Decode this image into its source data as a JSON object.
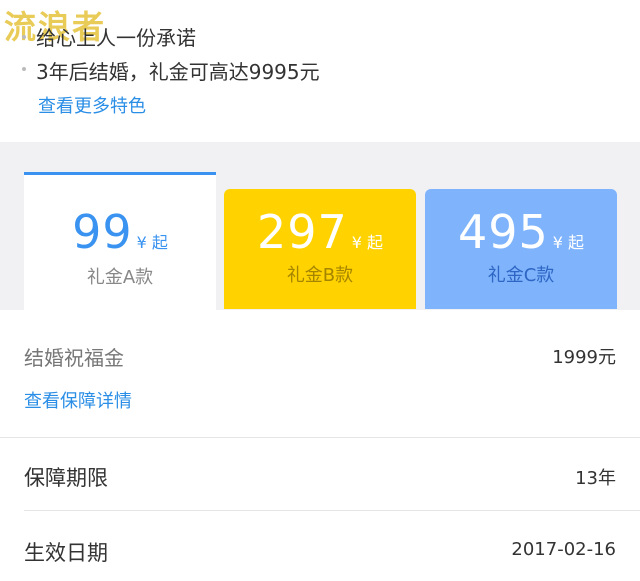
{
  "watermark": "流浪者",
  "features": {
    "items": [
      "给心上人一份承诺",
      "3年后结婚，礼金可高达9995元"
    ],
    "more_link": "查看更多特色"
  },
  "plans": [
    {
      "price": "99",
      "suffix": "¥ 起",
      "name": "礼金A款",
      "selected": true
    },
    {
      "price": "297",
      "suffix": "¥ 起",
      "name": "礼金B款",
      "selected": false
    },
    {
      "price": "495",
      "suffix": "¥ 起",
      "name": "礼金C款",
      "selected": false
    }
  ],
  "detail": {
    "blessing_label": "结婚祝福金",
    "blessing_value": "1999元",
    "guarantee_link": "查看保障详情",
    "term_label": "保障期限",
    "term_value": "13年",
    "effective_label": "生效日期",
    "effective_value": "2017-02-16"
  },
  "colors": {
    "accent_blue": "#3a93f0",
    "link_blue": "#2a8ee6",
    "plan_b_yellow": "#ffd200",
    "plan_c_blue": "#7fb3fb",
    "band_gray": "#f1f1f4"
  }
}
